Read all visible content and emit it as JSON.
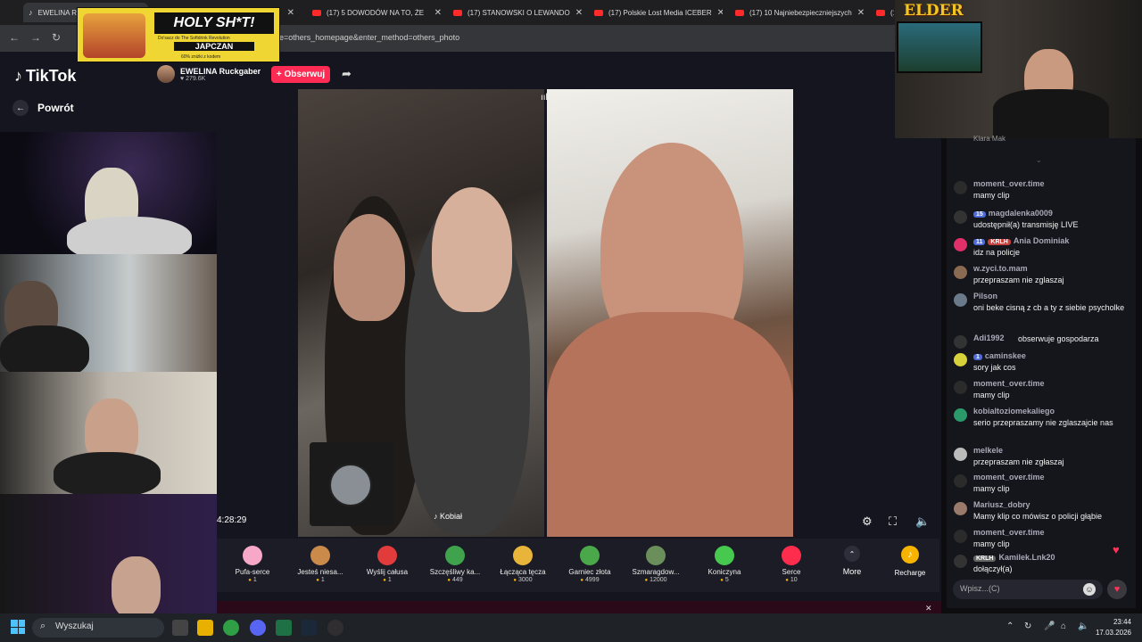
{
  "browser": {
    "tabs": [
      {
        "title": "EWELINA Ruckgaber",
        "active": true
      },
      {
        "title": "(17) 5 DOWODÓW NA TO, ŻE",
        "active": false
      },
      {
        "title": "(17) STANOWSKI O LEWANDO",
        "active": false
      },
      {
        "title": "(17) Polskie Lost Media ICEBER",
        "active": false
      },
      {
        "title": "(17) 10 Najniebezpieczniejszych",
        "active": false
      },
      {
        "title": "(1",
        "active": false
      }
    ],
    "partial_tab": "ma",
    "url": "erge=others_homepage&enter_method=others_photo"
  },
  "banner": {
    "headline": "HOLY SH*T!",
    "sub": "Do'sacz do The Softdrink Revolution",
    "brand": "JAPCZAN",
    "tiny": "60% zniżki z kodem"
  },
  "streamer_overlay": {
    "logo": "ELDER"
  },
  "tiktok": {
    "logo": "TikTok",
    "back_label": "Powrót",
    "host_name": "EWELINA Ruckgaber",
    "host_likes": "279.6K",
    "follow_label": "+ Obserwuj",
    "guest_label": "Kobiał",
    "timer": "4:28:29",
    "gifts": [
      {
        "name": "Pufa-serce",
        "price": "1",
        "color": "#f7a8c9"
      },
      {
        "name": "Jesteś niesa...",
        "price": "1",
        "color": "#c98a4a"
      },
      {
        "name": "Wyślij całusa",
        "price": "1",
        "color": "#e23b3b"
      },
      {
        "name": "Szczęśliwy ka...",
        "price": "449",
        "color": "#3fa34d"
      },
      {
        "name": "Łącząca tęcza",
        "price": "3000",
        "color": "#e8b53a"
      },
      {
        "name": "Garniec złota",
        "price": "4999",
        "color": "#4aa84a"
      },
      {
        "name": "Szmaragdow...",
        "price": "12000",
        "color": "#6b8f5a"
      },
      {
        "name": "Koniczyna",
        "price": "5",
        "color": "#46c94e"
      },
      {
        "name": "Serce",
        "price": "10",
        "color": "#ff2d4d"
      }
    ],
    "more_label": "More",
    "recharge_label": "Recharge"
  },
  "chat": {
    "top_user": "Klara Mak",
    "messages": [
      {
        "user": "moment_over.time",
        "text": "mamy clip",
        "avatar": "#2b2b2b",
        "badges": []
      },
      {
        "user": "magdalenka0009",
        "text": "udostępnił(a) transmisję LIVE",
        "avatar": "#333",
        "badges": [
          {
            "label": "15",
            "cls": "b-blue"
          }
        ]
      },
      {
        "user": "Ania Dominiak",
        "text": "idz na policje",
        "avatar": "#e0306a",
        "badges": [
          {
            "label": "11",
            "cls": "b-blue"
          },
          {
            "label": "KRLH",
            "cls": "b-red"
          }
        ]
      },
      {
        "user": "w.zyci.to.mam",
        "text": "przepraszam nie zglaszaj",
        "avatar": "#8a6a50",
        "badges": []
      },
      {
        "user": "Pilson",
        "text": "oni beke cisną z cb a ty z siebie psycholke",
        "avatar": "#6a7a8a",
        "badges": []
      },
      {
        "user": "Adi1992",
        "text": "obserwuje gospodarza",
        "avatar": "#333",
        "badges": []
      },
      {
        "user": "caminskee",
        "text": "sory jak cos",
        "avatar": "#d8d23a",
        "badges": [
          {
            "label": "1",
            "cls": "b-blue"
          }
        ]
      },
      {
        "user": "moment_over.time",
        "text": "mamy clip",
        "avatar": "#2b2b2b",
        "badges": []
      },
      {
        "user": "kobialtoziomekaliego",
        "text": "serio przepraszamy nie zglaszajcie nas",
        "avatar": "#2a9a6a",
        "badges": []
      },
      {
        "user": "melkele",
        "text": "przepraszam nie zgłaszaj",
        "avatar": "#bbb",
        "badges": []
      },
      {
        "user": "moment_over.time",
        "text": "mamy clip",
        "avatar": "#2b2b2b",
        "badges": []
      },
      {
        "user": "Mariusz_dobry",
        "text": "Mamy klip co mówisz o policji głąbie",
        "avatar": "#9a7a6a",
        "badges": []
      },
      {
        "user": "moment_over.time",
        "text": "mamy clip",
        "avatar": "#2b2b2b",
        "badges": []
      },
      {
        "user": "Kamilek.Lnk20",
        "text": "dołączył(a)",
        "avatar": "#333",
        "badges": [
          {
            "label": "KRLH",
            "cls": "b-grey"
          }
        ]
      }
    ],
    "input_placeholder": "Wpisz...(C)"
  },
  "taskbar": {
    "search_placeholder": "Wyszukaj",
    "time": "23:44",
    "date": "17.03.2026"
  }
}
